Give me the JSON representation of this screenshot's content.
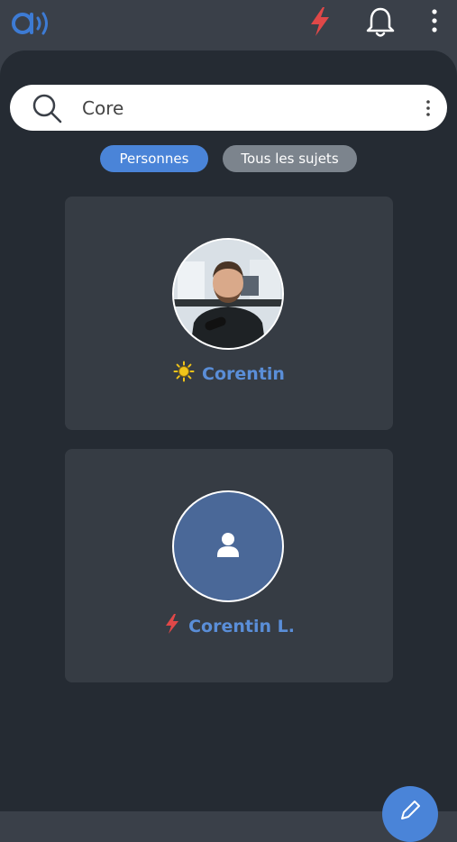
{
  "header": {
    "logo_icon": "app-logo-icon",
    "flash_icon": "bolt-icon",
    "bell_icon": "bell-icon",
    "menu_icon": "kebab-menu-icon"
  },
  "search": {
    "value": "Core",
    "placeholder": "",
    "icon": "search-icon",
    "menu_icon": "kebab-menu-icon"
  },
  "filters": [
    {
      "label": "Personnes",
      "active": true
    },
    {
      "label": "Tous les sujets",
      "active": false
    }
  ],
  "results": [
    {
      "name": "Corentin",
      "status_icon": "sun-icon",
      "status_color": "#f0c419",
      "avatar": "photo"
    },
    {
      "name": "Corentin L.",
      "status_icon": "bolt-icon",
      "status_color": "#e04848",
      "avatar": "default-person-icon"
    }
  ],
  "fab": {
    "icon": "compose-icon"
  },
  "colors": {
    "accent": "#4a84d8",
    "background": "#252b33",
    "topbar": "#3a4049",
    "card": "#363c44",
    "name_text": "#5a8ed8",
    "bolt_red": "#e04848"
  }
}
